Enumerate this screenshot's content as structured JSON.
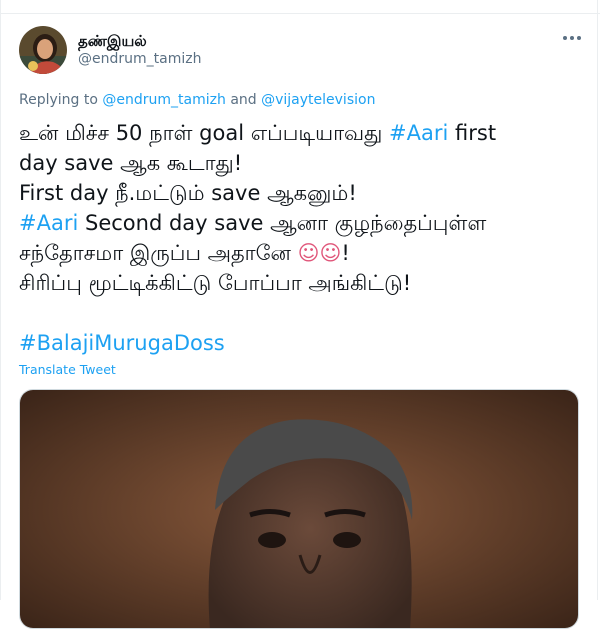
{
  "tweet": {
    "display_name": "தண்இயல்",
    "handle": "@endrum_tamizh",
    "replying_prefix": "Replying to",
    "replying_user1": "@endrum_tamizh",
    "replying_and": "and",
    "replying_user2": "@vijaytelevision",
    "line1_a": "உன் மிச்ச 50 நாள் goal எப்படியாவது",
    "line1_tag": "#Aari",
    "line1_b": "first",
    "line2": "day save ஆக கூடாது!",
    "line3": "First day நீ.மட்டும் save ஆகனும்!",
    "line4_tag": "#Aari",
    "line4_b": "Second day save ஆனா குழந்தைப்புள்ள",
    "line5_a": "சந்தோசமா இருப்ப அதானே",
    "line5_emoji": "☺☺",
    "line5_b": "!",
    "line6": "சிரிப்பு மூட்டிக்கிட்டு போப்பா அங்கிட்டு!",
    "hashtag_line": "#BalajiMurugaDoss",
    "translate_label": "Translate Tweet"
  },
  "icons": {
    "avatar": "avatar-photo",
    "more": "more-icon",
    "emoji": "smiling-face-emoji"
  },
  "colors": {
    "link": "#1da1f2",
    "muted": "#5b7083",
    "text": "#0f1419"
  }
}
